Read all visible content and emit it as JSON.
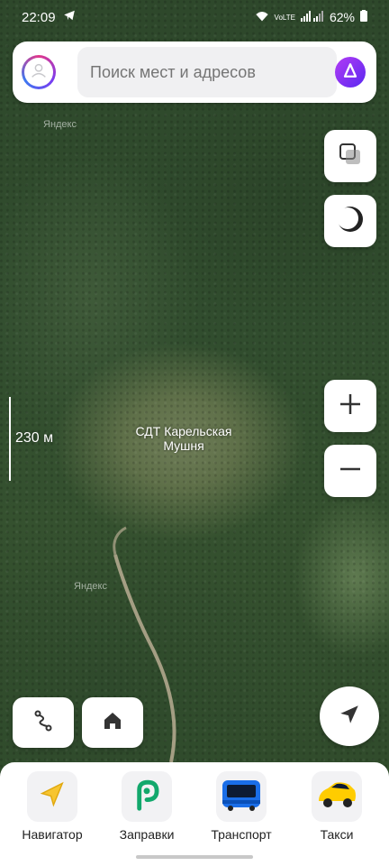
{
  "status_bar": {
    "time": "22:09",
    "network_label": "VoLTE",
    "battery": "62%"
  },
  "search": {
    "placeholder": "Поиск мест и адресов"
  },
  "map": {
    "watermark": "Яндекс",
    "scale_label": "230 м",
    "place_label": "СДТ Карельская Мушня"
  },
  "shortcuts": [
    {
      "label": "Навигатор",
      "icon": "navigator-arrow-icon"
    },
    {
      "label": "Заправки",
      "icon": "fuel-logo-icon"
    },
    {
      "label": "Транспорт",
      "icon": "bus-icon"
    },
    {
      "label": "Такси",
      "icon": "taxi-car-icon"
    }
  ],
  "colors": {
    "alice_accent": "#7a3cf0",
    "navigator_yellow": "#f7c531",
    "fuel_green": "#12a86c",
    "transport_blue": "#1a6ee8",
    "taxi_yellow": "#ffcc00"
  }
}
